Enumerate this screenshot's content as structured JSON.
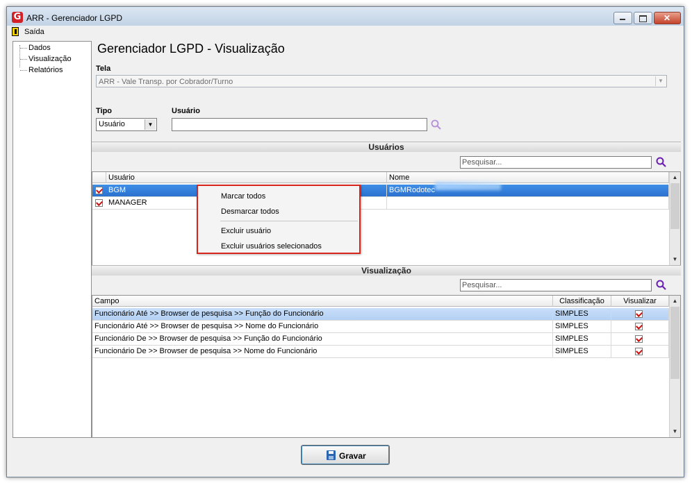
{
  "window": {
    "title": "ARR - Gerenciador LGPD"
  },
  "menu": {
    "saida": "Saída"
  },
  "nav": {
    "items": [
      "Dados",
      "Visualização",
      "Relatórios"
    ]
  },
  "page": {
    "title": "Gerenciador LGPD - Visualização"
  },
  "tela": {
    "label": "Tela",
    "value": "ARR - Vale Transp. por Cobrador/Turno"
  },
  "tipo": {
    "label": "Tipo",
    "value": "Usuário"
  },
  "usuario": {
    "label": "Usuário",
    "value": ""
  },
  "usuarios_section": {
    "title": "Usuários",
    "search_placeholder": "Pesquisar...",
    "columns": [
      "Usuário",
      "Nome"
    ],
    "rows": [
      {
        "checked": true,
        "usuario": "BGM",
        "nome": "BGMRodotec",
        "selected": true
      },
      {
        "checked": true,
        "usuario": "MANAGER",
        "nome": "",
        "selected": false
      }
    ]
  },
  "context_menu": {
    "items": [
      "Marcar todos",
      "Desmarcar todos",
      "Excluir usuário",
      "Excluir usuários selecionados"
    ],
    "highlight_color": "#d9241c"
  },
  "visualizacao_section": {
    "title": "Visualização",
    "search_placeholder": "Pesquisar...",
    "columns": [
      "Campo",
      "Classificação",
      "Visualizar"
    ],
    "rows": [
      {
        "campo": "Funcionário Até >> Browser de pesquisa >> Função do Funcionário",
        "classificacao": "SIMPLES",
        "visualizar": true
      },
      {
        "campo": "Funcionário Até >> Browser de pesquisa >> Nome do Funcionário",
        "classificacao": "SIMPLES",
        "visualizar": true
      },
      {
        "campo": "Funcionário De >> Browser de pesquisa >> Função do Funcionário",
        "classificacao": "SIMPLES",
        "visualizar": true
      },
      {
        "campo": "Funcionário De >> Browser de pesquisa >> Nome do Funcionário",
        "classificacao": "SIMPLES",
        "visualizar": true
      }
    ]
  },
  "footer": {
    "gravar": "Gravar"
  },
  "colors": {
    "accent": "#2a72cf",
    "search_icon": "#6a1fb3",
    "check": "#cc1010"
  }
}
